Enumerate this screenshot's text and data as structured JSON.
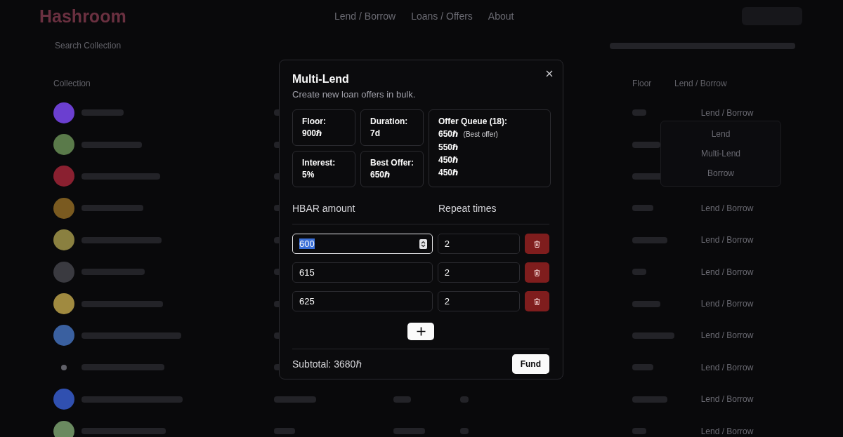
{
  "header": {
    "logo": "Hashroom",
    "nav": [
      "Lend / Borrow",
      "Loans / Offers",
      "About"
    ]
  },
  "search": {
    "placeholder": "Search Collection"
  },
  "table": {
    "columns": [
      "Collection",
      "Floor",
      "Lend / Borrow"
    ],
    "rows": [
      {
        "kind": "avatar",
        "color": "#6b3fd0",
        "action": "Lend / Borrow"
      },
      {
        "kind": "avatar",
        "color": "#5a7a4a",
        "menu": [
          "Lend",
          "Multi-Lend",
          "Borrow"
        ]
      },
      {
        "kind": "avatar",
        "color": "#8a2030"
      },
      {
        "kind": "avatar",
        "color": "#7a5a20",
        "action": "Lend / Borrow"
      },
      {
        "kind": "avatar",
        "color": "#8a8040",
        "action": "Lend / Borrow"
      },
      {
        "kind": "avatar",
        "color": "#3a3a40",
        "action": "Lend / Borrow"
      },
      {
        "kind": "avatar",
        "color": "#a08a40",
        "action": "Lend / Borrow"
      },
      {
        "kind": "avatar",
        "color": "#3a60a0",
        "action": "Lend / Borrow"
      },
      {
        "kind": "icon",
        "color": "#606068",
        "action": "Lend / Borrow"
      },
      {
        "kind": "avatar",
        "color": "#3050b0",
        "action": "Lend / Borrow"
      },
      {
        "kind": "avatar",
        "color": "#6a8a60",
        "action": "Lend / Borrow"
      }
    ]
  },
  "modal": {
    "title": "Multi-Lend",
    "subtitle": "Create new loan offers in bulk.",
    "stats": [
      {
        "label": "Floor:",
        "value": "900ℏ"
      },
      {
        "label": "Duration:",
        "value": "7d"
      },
      {
        "label": "Interest:",
        "value": "5%"
      },
      {
        "label": "Best Offer:",
        "value": "650ℏ"
      }
    ],
    "queue": {
      "title": "Offer Queue (18):",
      "offers": [
        {
          "amount": "650ℏ",
          "tag": "(Best offer)"
        },
        {
          "amount": "550ℏ"
        },
        {
          "amount": "450ℏ"
        },
        {
          "amount": "450ℏ"
        }
      ]
    },
    "columns": [
      "HBAR amount",
      "Repeat times"
    ],
    "entries": [
      {
        "amount": "600",
        "repeat": "2",
        "focused": true
      },
      {
        "amount": "615",
        "repeat": "2",
        "focused": false
      },
      {
        "amount": "625",
        "repeat": "2",
        "focused": false
      }
    ],
    "subtotal": "Subtotal: 3680ℏ",
    "fund": "Fund"
  }
}
